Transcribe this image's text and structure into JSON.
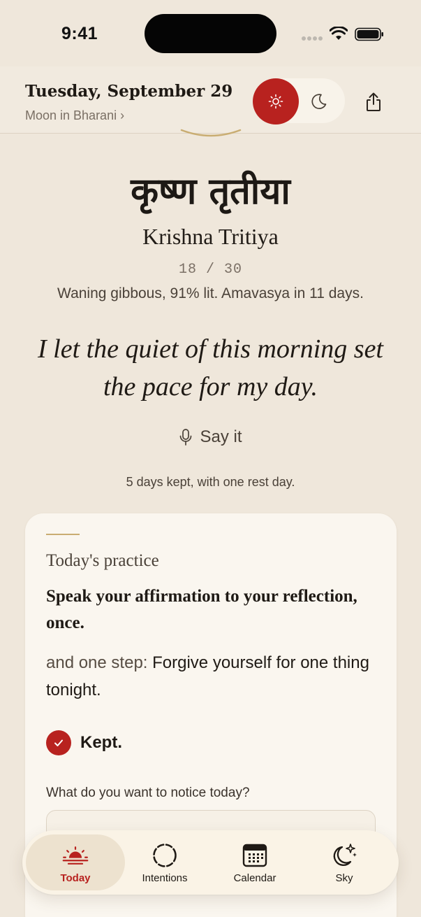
{
  "status_bar": {
    "time": "9:41"
  },
  "header": {
    "date": "Tuesday, September 29",
    "moon_link": "Moon in Bharani ›",
    "theme_toggle": {
      "selected": "day"
    }
  },
  "hero": {
    "sanskrit_name": "कृष्ण तृतीया",
    "transliteration": "Krishna Tritiya",
    "day_count": "18 / 30",
    "phase_text": "Waning gibbous, 91% lit. Amavasya in 11 days.",
    "affirmation": "I let the quiet of this morning set the pace for my day.",
    "say_it_label": "Say it",
    "streak_text": "5 days kept, with one rest day."
  },
  "practice": {
    "heading": "Today's practice",
    "title": "Speak your affirmation to your reflection, once.",
    "step_lead": "and one step:",
    "step_text": "Forgive yourself for one thing tonight.",
    "kept_label": "Kept.",
    "notice_label": "What do you want to notice today?",
    "notice_value": ""
  },
  "tabs": [
    {
      "label": "Today",
      "icon": "sunrise-icon",
      "active": true
    },
    {
      "label": "Intentions",
      "icon": "dashed-circle-icon",
      "active": false
    },
    {
      "label": "Calendar",
      "icon": "calendar-icon",
      "active": false
    },
    {
      "label": "Sky",
      "icon": "moon-stars-icon",
      "active": false
    }
  ],
  "colors": {
    "accent": "#b8221f",
    "background": "#efe7db",
    "card": "#faf6ef",
    "gold": "#c9ad72"
  }
}
